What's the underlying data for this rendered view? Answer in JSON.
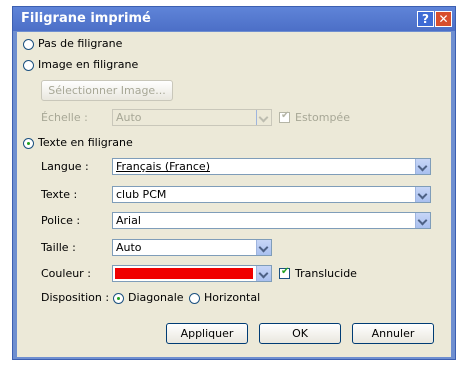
{
  "dialog": {
    "title": "Filigrane imprimé",
    "help_glyph": "?",
    "close_glyph": "✕"
  },
  "options": {
    "none_label": "Pas de filigrane",
    "image_label": "Image en filigrane",
    "select_image_button": "Sélectionner Image...",
    "scale_label": "Échelle :",
    "scale_value": "Auto",
    "washout_label": "Estompée",
    "text_label": "Texte en filigrane"
  },
  "text_settings": {
    "language_label": "Langue :",
    "language_value": "Français (France)",
    "text_label": "Texte :",
    "text_value": "club PCM",
    "font_label": "Police :",
    "font_value": "Arial",
    "size_label": "Taille :",
    "size_value": "Auto",
    "color_label": "Couleur :",
    "color_value": "#f00000",
    "translucent_label": "Translucide",
    "layout_label": "Disposition :",
    "diagonal_label": "Diagonale",
    "horizontal_label": "Horizontal"
  },
  "buttons": {
    "apply": "Appliquer",
    "ok": "OK",
    "cancel": "Annuler"
  }
}
